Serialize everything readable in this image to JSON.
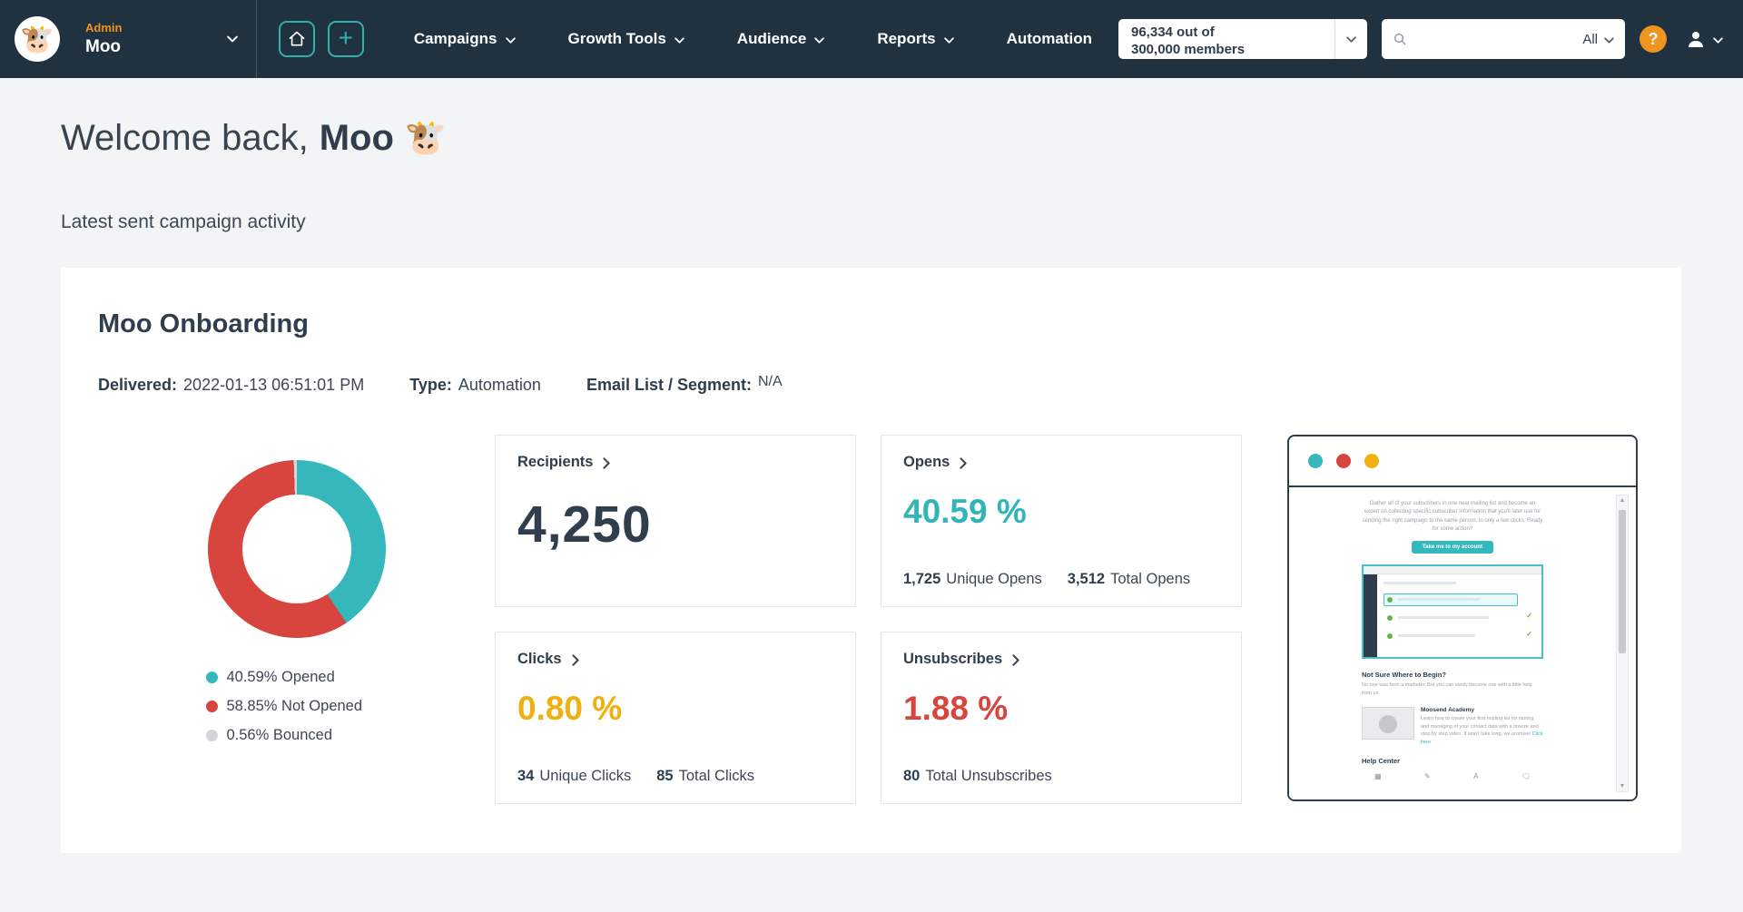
{
  "colors": {
    "navbar": "#203140",
    "teal": "#2fb1a9",
    "orange": "#f0941f",
    "red": "#d8453e",
    "yellow": "#eeb111"
  },
  "navbar": {
    "logo_emoji": "🐮",
    "account": {
      "role": "Admin",
      "name": "Moo"
    },
    "nav_items": [
      {
        "label": "Campaigns"
      },
      {
        "label": "Growth Tools"
      },
      {
        "label": "Audience"
      },
      {
        "label": "Reports"
      },
      {
        "label": "Automation"
      }
    ],
    "members_dropdown": {
      "line1": "96,334 out of",
      "line2": "300,000 members"
    },
    "search": {
      "placeholder": "",
      "filter_label": "All"
    },
    "help_label": "?"
  },
  "page": {
    "welcome_prefix": "Welcome back,",
    "welcome_name": "Moo",
    "welcome_emoji": "🐮",
    "subtitle": "Latest sent campaign activity"
  },
  "campaign": {
    "title": "Moo Onboarding",
    "delivered": {
      "label": "Delivered:",
      "value": "2022-01-13 06:51:01 PM"
    },
    "type": {
      "label": "Type:",
      "value": "Automation"
    },
    "segment": {
      "label": "Email List / Segment:",
      "value": "N/A"
    },
    "recipients": {
      "label": "Recipients",
      "value": "4,250"
    },
    "opens": {
      "label": "Opens",
      "value": "40.59 %",
      "color": "#31b5b8",
      "unique_count": "1,725",
      "unique_label": "Unique Opens",
      "total_count": "3,512",
      "total_label": "Total Opens"
    },
    "clicks": {
      "label": "Clicks",
      "value": "0.80 %",
      "color": "#eeb111",
      "unique_count": "34",
      "unique_label": "Unique Clicks",
      "total_count": "85",
      "total_label": "Total Clicks"
    },
    "unsubscribes": {
      "label": "Unsubscribes",
      "value": "1.88 %",
      "color": "#d8453e",
      "total_count": "80",
      "total_label": "Total Unsubscribes"
    }
  },
  "chart_data": {
    "type": "pie",
    "donut": true,
    "labels": [
      "Opened",
      "Not Opened",
      "Bounced"
    ],
    "values": [
      40.59,
      58.85,
      0.56
    ],
    "colors": [
      "#35b7bc",
      "#d8453e",
      "#d3d6d8"
    ],
    "legend": [
      "40.59% Opened",
      "58.85% Not Opened",
      "0.56% Bounced"
    ],
    "legend_position": "bottom",
    "title": ""
  },
  "preview": {
    "dots": [
      "#35b7bc",
      "#d8453e",
      "#eeb111"
    ],
    "email": {
      "intro": "Gather all of your subscribers in one neat mailing list and become an expert on collecting specific subscriber information that you'll later use for sending the right campaign to the same person, in only a few clicks. Ready for some action?",
      "cta": "Take me to my account",
      "section1_title": "Not Sure Where to Begin?",
      "section1_text": "No one was born a marketer. But you can easily become one with a little help from us.",
      "section2_title": "Moosend Academy",
      "section2_text": "Learn how to create your first mailing list for storing and managing of your contact data with a breeze and step by step video. It won't take long, we promise!",
      "section2_link": "Click here",
      "section3_title": "Help Center"
    }
  }
}
